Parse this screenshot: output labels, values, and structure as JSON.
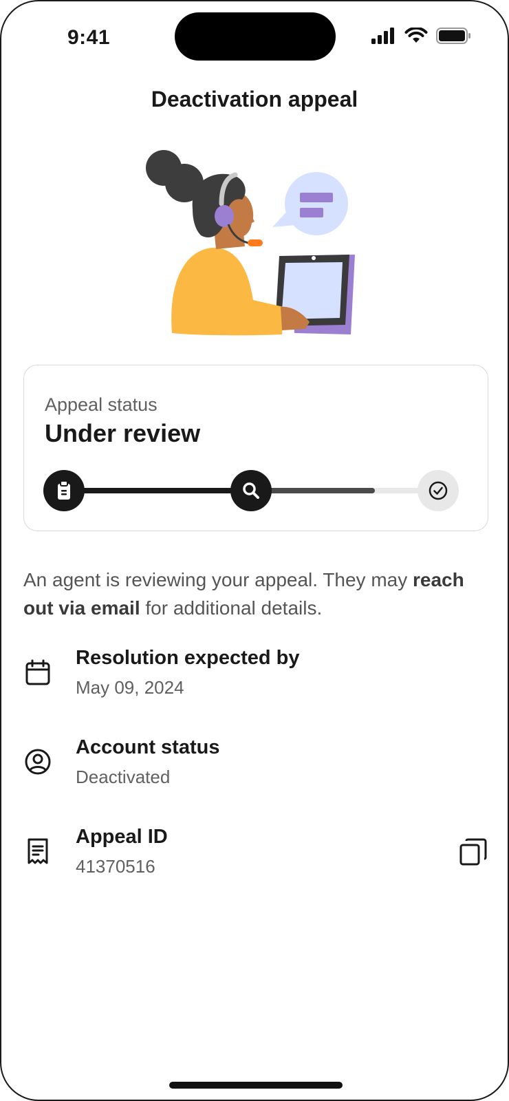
{
  "status_bar": {
    "time": "9:41"
  },
  "header": {
    "title": "Deactivation appeal"
  },
  "illustration": {
    "name": "support-agent-illustration"
  },
  "appeal_card": {
    "label": "Appeal status",
    "status": "Under review",
    "steps": [
      {
        "name": "submitted",
        "icon": "clipboard-icon",
        "state": "done"
      },
      {
        "name": "in-review",
        "icon": "search-icon",
        "state": "current"
      },
      {
        "name": "resolved",
        "icon": "check-circle-icon",
        "state": "pending"
      }
    ],
    "progress_within_review": 0.6
  },
  "description": {
    "part1": "An agent is reviewing your appeal. They may ",
    "emphasis": "reach out via email",
    "part2": " for additional details."
  },
  "details": [
    {
      "icon": "calendar-icon",
      "title": "Resolution expected by",
      "value": "May 09, 2024"
    },
    {
      "icon": "account-circle-icon",
      "title": "Account status",
      "value": "Deactivated"
    },
    {
      "icon": "receipt-icon",
      "title": "Appeal ID",
      "value": "41370516",
      "action_icon": "copy-icon"
    }
  ],
  "colors": {
    "text_primary": "#191919",
    "text_secondary": "#606060",
    "progress_done": "#191919",
    "progress_track": "#e8e8e8",
    "illustration_yellow": "#FBB843",
    "illustration_purple": "#9B7FD1",
    "illustration_bubble": "#D6E1FF"
  }
}
